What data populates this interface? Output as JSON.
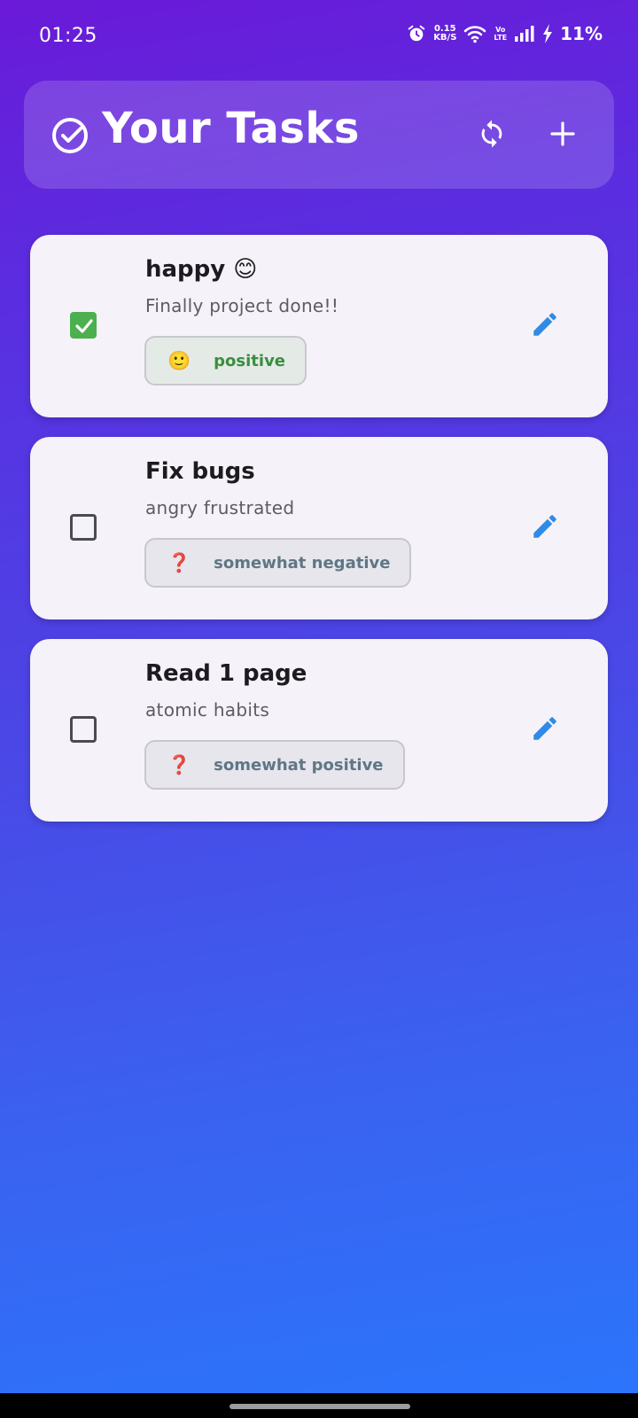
{
  "status_bar": {
    "time": "01:25",
    "net_speed_value": "0.15",
    "net_speed_unit": "KB/S",
    "volte_top": "Vo",
    "volte_bottom": "LTE",
    "battery": "11%"
  },
  "header": {
    "title": "Your Tasks",
    "check_icon": "check-circle-icon",
    "refresh_icon": "refresh-icon",
    "add_icon": "plus-icon"
  },
  "tasks": [
    {
      "title": "happy 😊",
      "description": "Finally project done!!",
      "completed": true,
      "sentiment": {
        "icon": "🙂",
        "label": "positive",
        "color": "#3a8e3e"
      }
    },
    {
      "title": "Fix bugs",
      "description": "angry frustrated",
      "completed": false,
      "sentiment": {
        "icon": "❓",
        "label": "somewhat negative",
        "color": "#607684"
      }
    },
    {
      "title": "Read 1 page",
      "description": "atomic habits",
      "completed": false,
      "sentiment": {
        "icon": "❓",
        "label": "somewhat positive",
        "color": "#607684"
      }
    }
  ],
  "colors": {
    "accent_edit": "#2f8be6",
    "check_green": "#4caf50",
    "gradient_top": "#6a1ad8",
    "gradient_bottom": "#2a76fc"
  }
}
